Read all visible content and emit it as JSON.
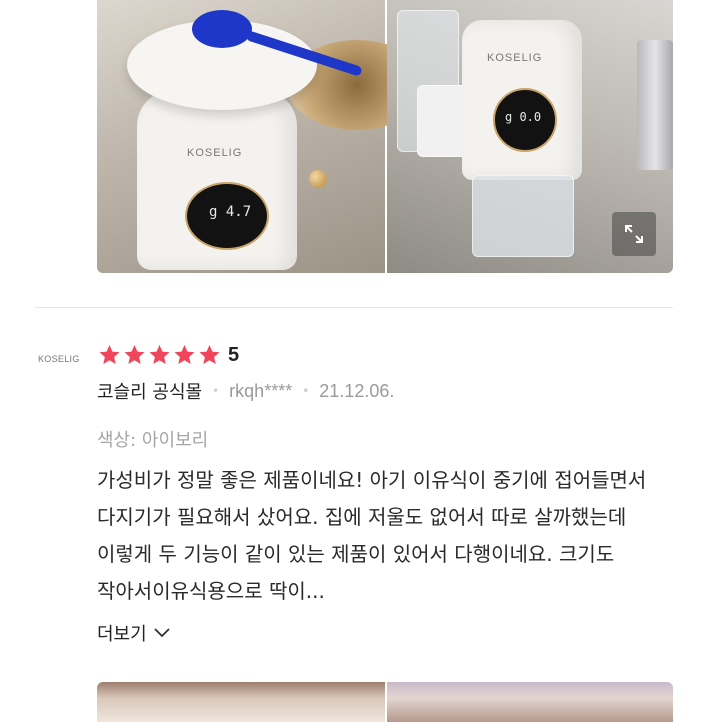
{
  "review": {
    "photos_top": [
      {
        "brand": "KOSELIG",
        "display": "g 4.7"
      },
      {
        "brand": "KOSELIG",
        "display": "g 0.0"
      }
    ],
    "store_logo": "KOSELIG",
    "rating": {
      "stars": 5,
      "max": 5,
      "score": "5"
    },
    "store_name": "코슬리 공식몰",
    "user": "rkqh****",
    "date": "21.12.06.",
    "option": "색상: 아이보리",
    "text": "가성비가 정말 좋은 제품이네요! 아기 이유식이 중기에 접어들면서 다지기가 필요해서 샀어요. 집에 저울도 없어서 따로 살까했는데 이렇게 두 기능이 같이 있는 제품이 있어서 다행이네요. 크기도 작아서이유식용으로 딱이...",
    "more_label": "더보기"
  },
  "colors": {
    "star": "#f0455a",
    "divider": "#e6e6e6",
    "meta_gray": "#9a9a9a"
  },
  "icons": [
    "expand-icon",
    "star-icon",
    "chevron-down-icon"
  ]
}
